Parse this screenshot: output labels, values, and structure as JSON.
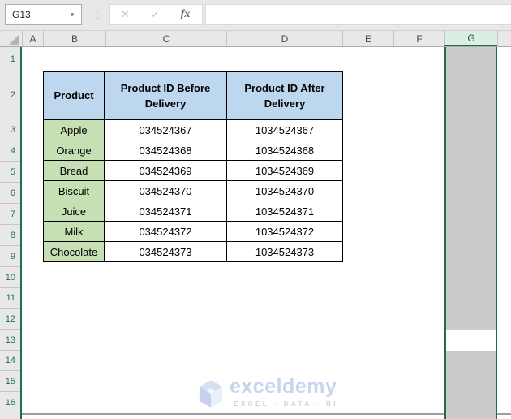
{
  "name_box": {
    "value": "G13",
    "dropdown_icon": "▾"
  },
  "formula_bar": {
    "grip_icon": "⋮",
    "cancel_icon": "✕",
    "enter_icon": "✓",
    "fx_icon": "fx",
    "value": ""
  },
  "column_headers": {
    "items": [
      "A",
      "B",
      "C",
      "D",
      "E",
      "F",
      "G"
    ],
    "selected": "G"
  },
  "row_headers": [
    "1",
    "2",
    "3",
    "4",
    "5",
    "6",
    "7",
    "8",
    "9",
    "10",
    "11",
    "12",
    "13",
    "14",
    "15",
    "16"
  ],
  "selection": {
    "active_cell": "G13",
    "selected_column": "G"
  },
  "table": {
    "headers": [
      "Product",
      "Product ID Before Delivery",
      "Product ID After Delivery"
    ],
    "rows": [
      {
        "product": "Apple",
        "before": "034524367",
        "after": "1034524367"
      },
      {
        "product": "Orange",
        "before": "034524368",
        "after": "1034524368"
      },
      {
        "product": "Bread",
        "before": "034524369",
        "after": "1034524369"
      },
      {
        "product": "Biscuit",
        "before": "034524370",
        "after": "1034524370"
      },
      {
        "product": "Juice",
        "before": "034524371",
        "after": "1034524371"
      },
      {
        "product": "Milk",
        "before": "034524372",
        "after": "1034524372"
      },
      {
        "product": "Chocolate",
        "before": "034524373",
        "after": "1034524373"
      }
    ]
  },
  "watermark": {
    "brand": "exceldemy",
    "tagline": "EXCEL - DATA - BI"
  },
  "colors": {
    "table_header_fill": "#BDD7EE",
    "product_fill": "#C6E0B4",
    "selection_fill": "#CBCBCB",
    "selection_border": "#1E7044",
    "selected_header_fill": "#DCEEE3",
    "accent_green": "#217346"
  }
}
